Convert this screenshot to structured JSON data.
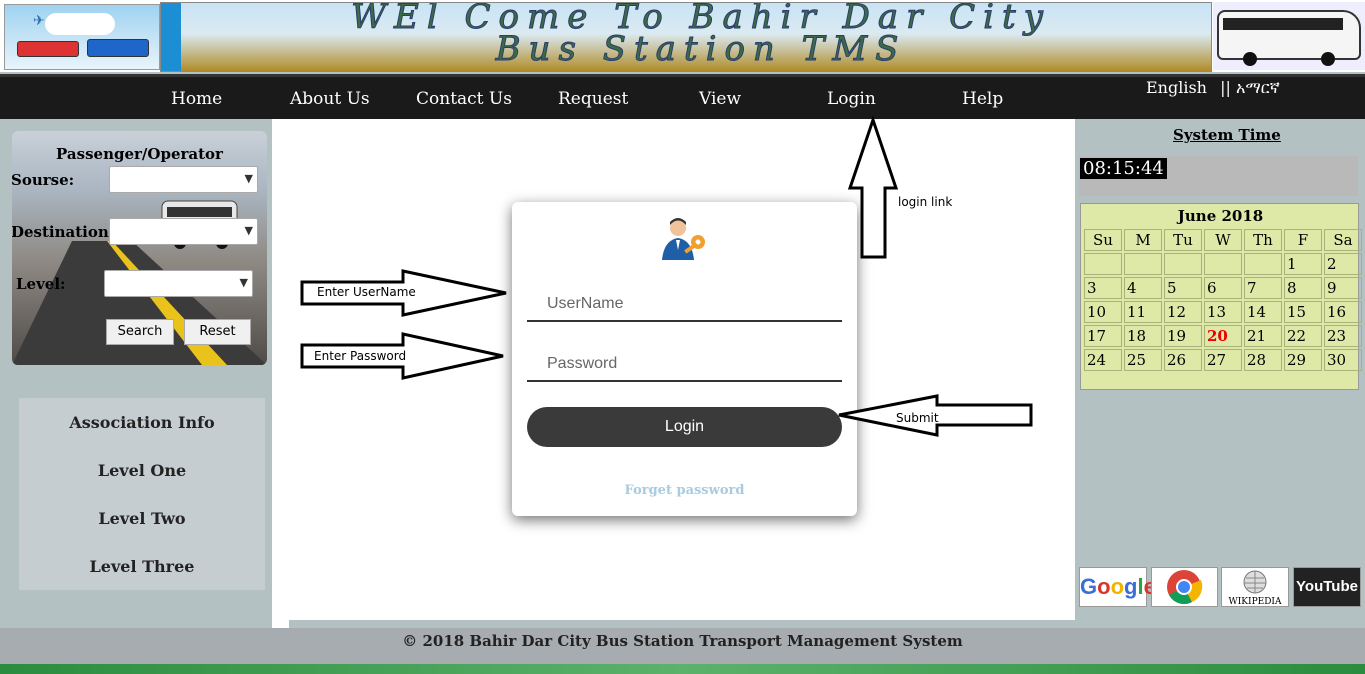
{
  "header": {
    "banner_line1": "WEl Come To Bahir Dar City",
    "banner_line2": "Bus Station TMS"
  },
  "nav": {
    "items": [
      "Home",
      "About Us",
      "Contact Us",
      "Request",
      "View",
      "Login",
      "Help"
    ],
    "lang_english": "English",
    "lang_sep": "||",
    "lang_amharic": "አማርኛ"
  },
  "search": {
    "title": "Passenger/Operator",
    "source_label": "Sourse:",
    "destination_label": "Destination:",
    "level_label": "Level:",
    "search_button": "Search",
    "reset_button": "Reset"
  },
  "association": {
    "items": [
      "Association Info",
      "Level One",
      "Level Two",
      "Level Three"
    ]
  },
  "login": {
    "username_placeholder": "UserName",
    "password_placeholder": "Password",
    "button": "Login",
    "forget": "Forget password"
  },
  "annotations": {
    "username": "Enter UserName",
    "password": "Enter Password",
    "submit": "Submit",
    "login_link": "login link"
  },
  "right": {
    "system_time_title": "System Time",
    "clock": "08:15:44",
    "calendar": {
      "title": "June 2018",
      "days": [
        "Su",
        "M",
        "Tu",
        "W",
        "Th",
        "F",
        "Sa"
      ],
      "weeks": [
        [
          "",
          "",
          "",
          "",
          "",
          "1",
          "2"
        ],
        [
          "3",
          "4",
          "5",
          "6",
          "7",
          "8",
          "9"
        ],
        [
          "10",
          "11",
          "12",
          "13",
          "14",
          "15",
          "16"
        ],
        [
          "17",
          "18",
          "19",
          "20",
          "21",
          "22",
          "23"
        ],
        [
          "24",
          "25",
          "26",
          "27",
          "28",
          "29",
          "30"
        ]
      ],
      "today": "20"
    },
    "logos": {
      "google": "Google",
      "wikipedia": "WIKIPEDIA",
      "youtube": "YouTube"
    }
  },
  "footer": {
    "text": "© 2018 Bahir Dar City Bus Station Transport Management System"
  },
  "colors": {
    "nav_bg": "#1a1a1a",
    "calendar_bg": "#dfe9a7",
    "today": "#e00000",
    "login_button": "#3a3a3a"
  }
}
